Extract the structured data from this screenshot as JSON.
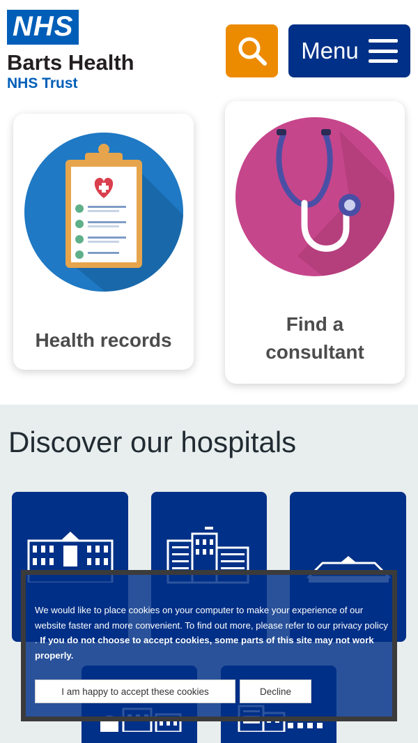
{
  "header": {
    "logo_nhs": "NHS",
    "org_name": "Barts Health",
    "org_sub": "NHS Trust",
    "search_icon": "search-icon",
    "menu_label": "Menu",
    "menu_icon": "hamburger-icon",
    "colors": {
      "nhs_blue": "#005eb8",
      "dark_blue": "#003087",
      "orange": "#ed8b00"
    }
  },
  "cards": [
    {
      "label": "Health records",
      "icon": "clipboard-heart-icon"
    },
    {
      "label": "Find a consultant",
      "icon": "stethoscope-icon"
    }
  ],
  "hospitals": {
    "heading": "Discover our hospitals",
    "tiles": [
      {
        "icon": "hospital-building-icon"
      },
      {
        "icon": "hospital-building-icon"
      },
      {
        "icon": "hospital-building-icon"
      },
      {
        "icon": "hospital-building-icon"
      },
      {
        "icon": "hospital-building-icon"
      }
    ]
  },
  "cookie_banner": {
    "text": "We would like to place cookies on your computer to make your experience of our website faster and more convenient. To find out more, please refer to our privacy policy .",
    "bold_text": "If you do not choose to accept cookies, some parts of this site may not work properly.",
    "accept_label": "I am happy to accept these cookies",
    "decline_label": "Decline"
  }
}
